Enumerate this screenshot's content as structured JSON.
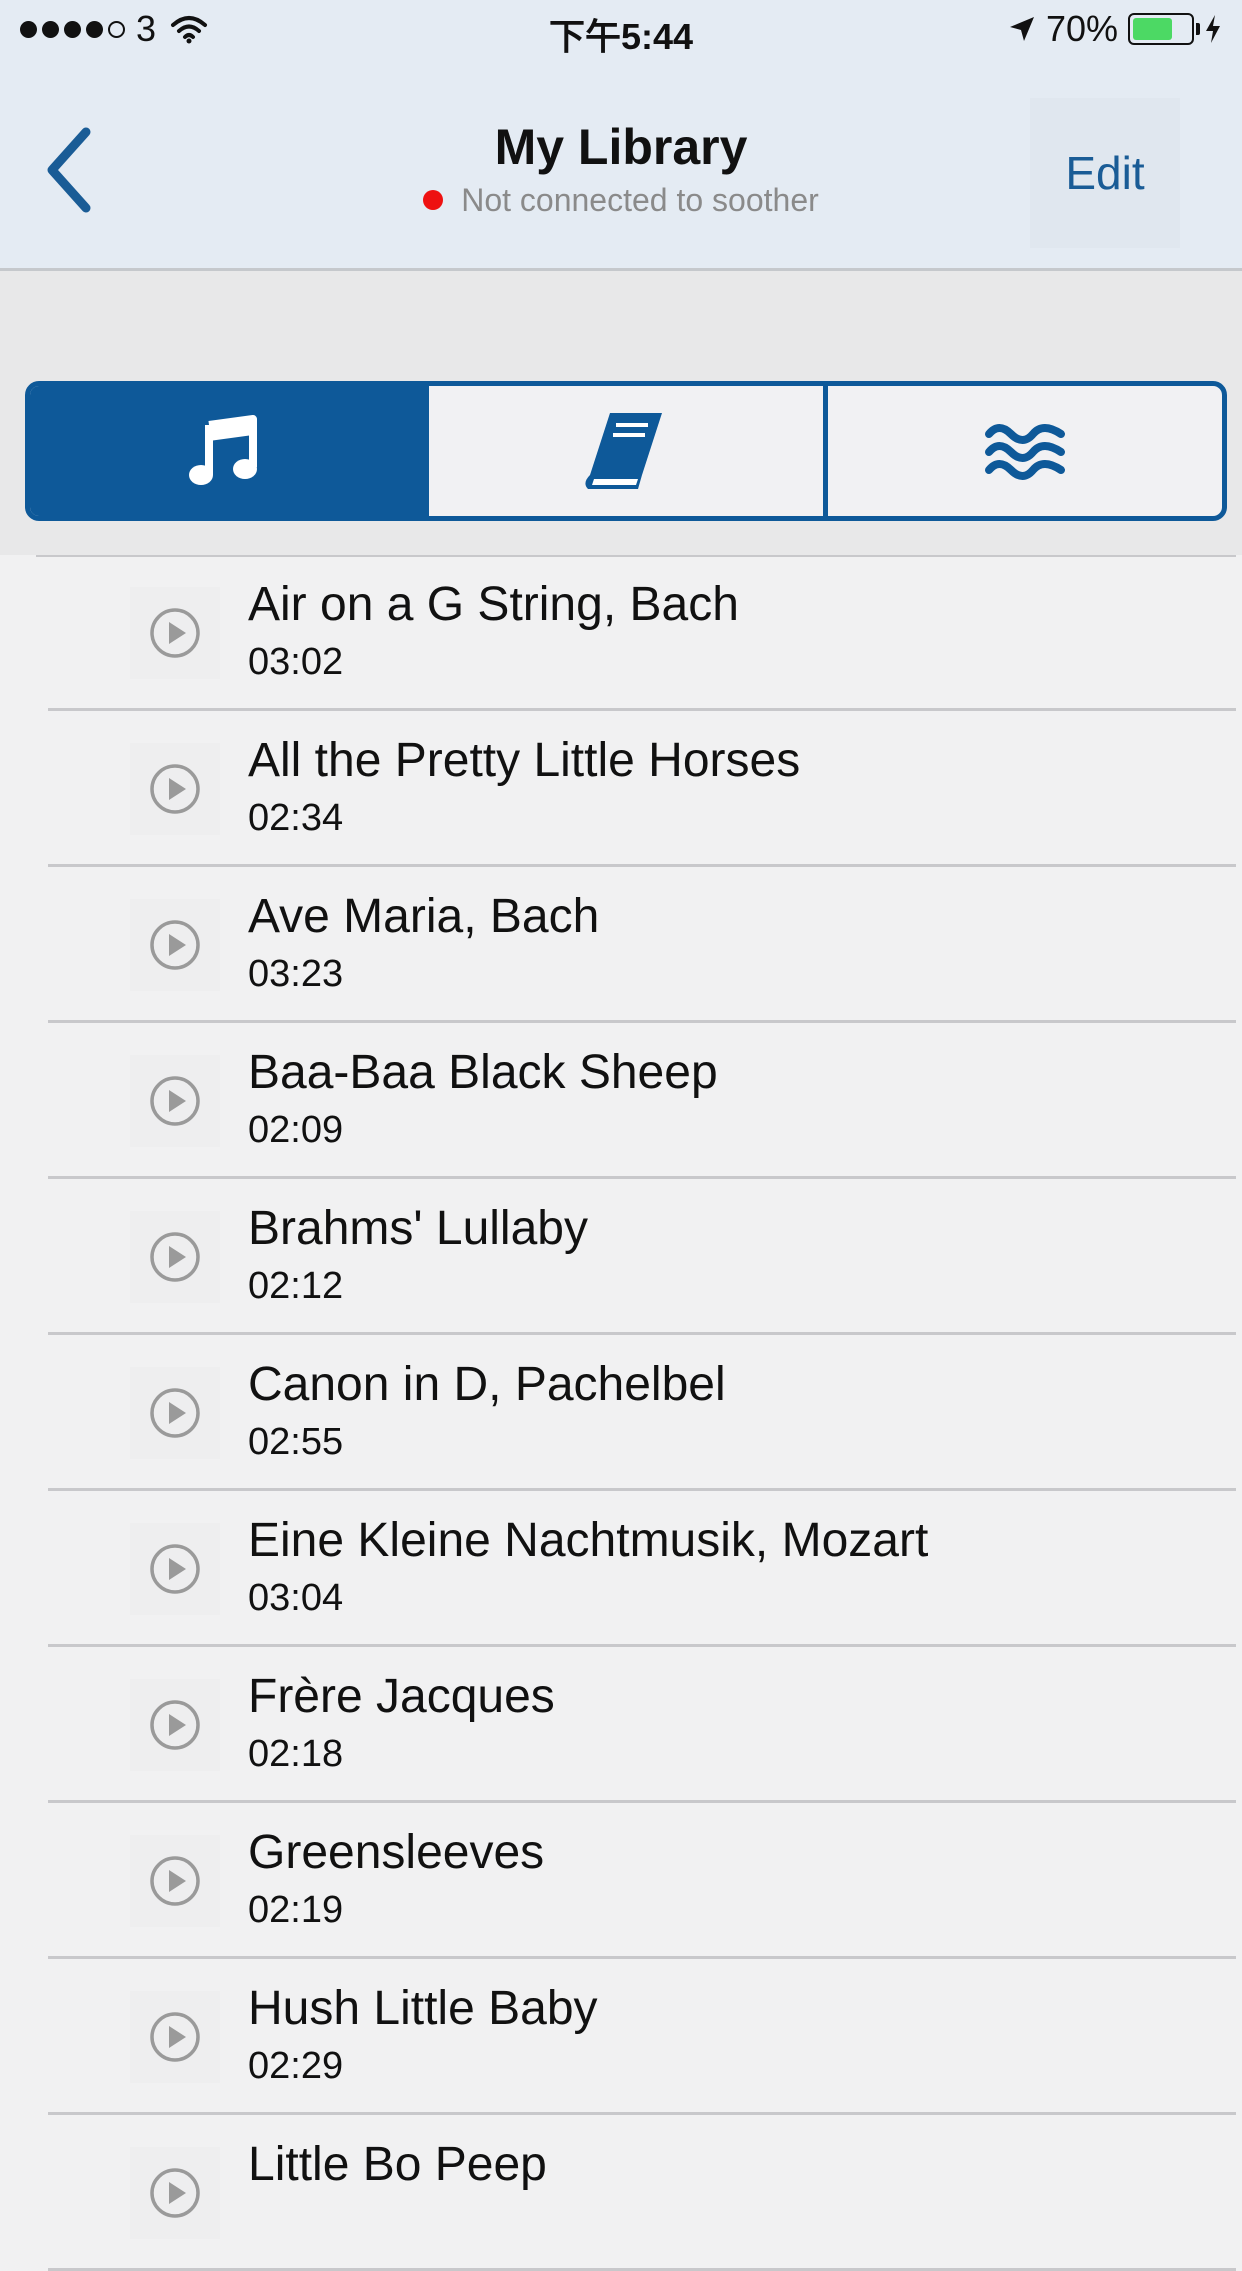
{
  "status_bar": {
    "carrier": "3",
    "time": "下午5:44",
    "battery": "70%",
    "battery_level": 0.7
  },
  "nav": {
    "title": "My Library",
    "subtitle": "Not connected to soother",
    "edit_label": "Edit"
  },
  "tabs": [
    {
      "icon": "music-note-icon",
      "active": true
    },
    {
      "icon": "book-icon",
      "active": false
    },
    {
      "icon": "waves-icon",
      "active": false
    }
  ],
  "colors": {
    "accent": "#0e5999",
    "nav_background": "#e4ebf3",
    "status_dot": "#ee1111"
  },
  "tracks": [
    {
      "title": "Air on a G String, Bach",
      "duration": "03:02"
    },
    {
      "title": "All the Pretty Little Horses",
      "duration": "02:34"
    },
    {
      "title": "Ave Maria, Bach",
      "duration": "03:23"
    },
    {
      "title": "Baa-Baa Black Sheep",
      "duration": "02:09"
    },
    {
      "title": "Brahms' Lullaby",
      "duration": "02:12"
    },
    {
      "title": "Canon in D, Pachelbel",
      "duration": "02:55"
    },
    {
      "title": "Eine Kleine Nachtmusik, Mozart",
      "duration": "03:04"
    },
    {
      "title": "Frère Jacques",
      "duration": "02:18"
    },
    {
      "title": "Greensleeves",
      "duration": "02:19"
    },
    {
      "title": "Hush Little Baby",
      "duration": "02:29"
    },
    {
      "title": "Little Bo Peep",
      "duration": ""
    }
  ]
}
